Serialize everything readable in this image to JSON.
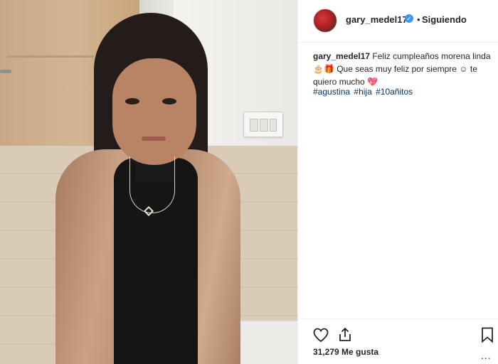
{
  "post": {
    "username": "gary_medel17",
    "verified": true,
    "separator": "•",
    "follow_status": "Siguiendo",
    "caption": {
      "username": "gary_medel17",
      "text": "Feliz cumpleaños morena linda 🎂🎁 Que seas muy feliz por siempre ☺ te quiero mucho 💖"
    },
    "hashtags": [
      "#agustina",
      "#hija",
      "#10añitos"
    ],
    "likes_count": "31,279",
    "likes_label": "Me gusta",
    "more": "..."
  },
  "icons": {
    "like": "heart-icon",
    "share": "share-icon",
    "save": "bookmark-icon",
    "verified": "verified-badge-icon"
  },
  "colors": {
    "verified": "#3897f0",
    "hashtag": "#003569",
    "text": "#262626",
    "border": "#efefef"
  }
}
